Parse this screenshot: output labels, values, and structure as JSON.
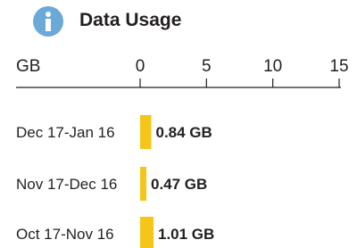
{
  "header": {
    "title": "Data Usage",
    "icon": "info-icon",
    "icon_color": "#6aa9d8"
  },
  "chart_data": {
    "type": "bar",
    "orientation": "horizontal",
    "title": "Data Usage",
    "xlabel": "GB",
    "ylabel": "",
    "xlim": [
      0,
      15
    ],
    "ticks": [
      0,
      5,
      10,
      15
    ],
    "categories": [
      "Dec 17-Jan 16",
      "Nov 17-Dec 16",
      "Oct 17-Nov 16"
    ],
    "values": [
      0.84,
      0.47,
      1.01
    ],
    "value_labels": [
      "0.84 GB",
      "0.47 GB",
      "1.01 GB"
    ],
    "bar_color": "#f5c518",
    "grid": false,
    "legend": "none"
  }
}
